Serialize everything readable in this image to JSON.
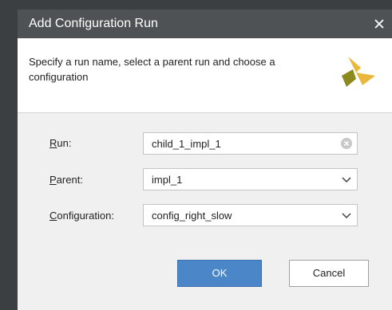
{
  "dialog": {
    "title": "Add Configuration Run",
    "close_icon": "close-icon",
    "description": "Specify a run name, select a parent run and choose a configuration",
    "logo_icon": "vivado-logo-icon"
  },
  "form": {
    "run": {
      "label_mnemonic": "R",
      "label_rest": "un:",
      "value": "child_1_impl_1",
      "clear_icon": "clear-icon"
    },
    "parent": {
      "label_mnemonic": "P",
      "label_rest": "arent:",
      "value": "impl_1",
      "dropdown_icon": "chevron-down-icon"
    },
    "configuration": {
      "label_mnemonic": "C",
      "label_rest": "onfiguration:",
      "value": "config_right_slow",
      "dropdown_icon": "chevron-down-icon"
    }
  },
  "buttons": {
    "ok": "OK",
    "cancel": "Cancel"
  },
  "colors": {
    "titlebar": "#4e5254",
    "ok_button": "#4a86c8",
    "logo_yellow": "#e9b83b",
    "logo_olive": "#8a8a1e"
  }
}
